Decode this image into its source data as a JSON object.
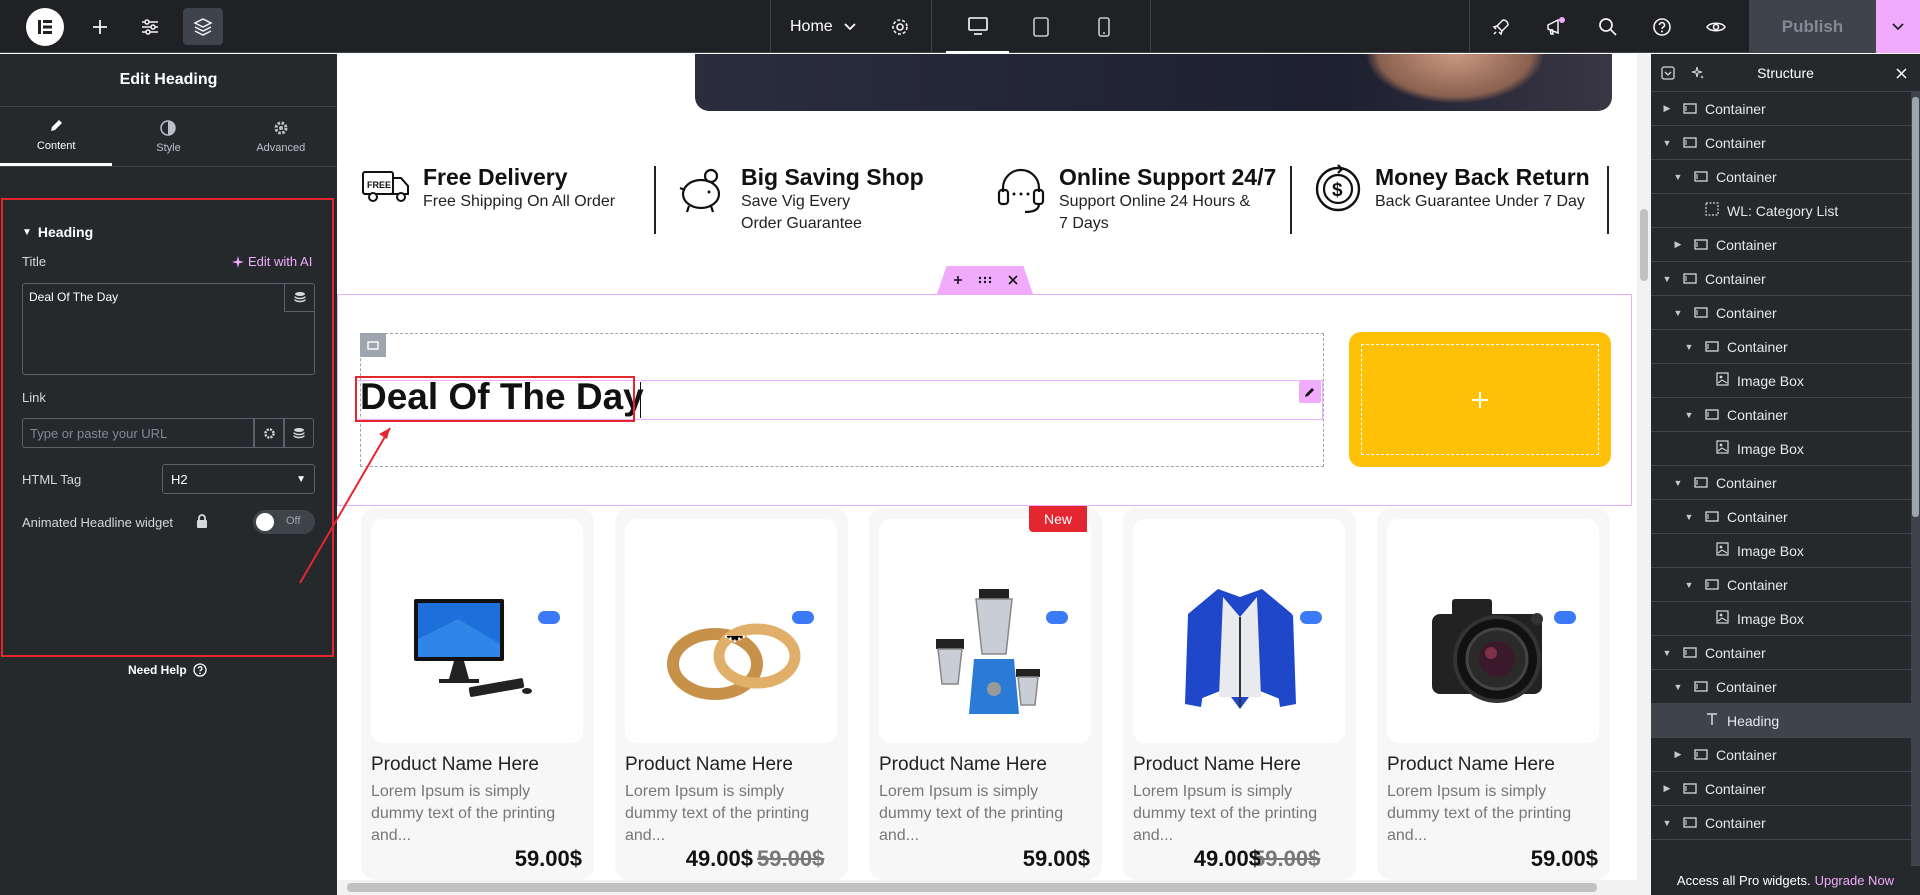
{
  "topbar": {
    "page_name": "Home",
    "publish_label": "Publish"
  },
  "left_panel": {
    "title": "Edit Heading",
    "tabs": [
      {
        "label": "Content"
      },
      {
        "label": "Style"
      },
      {
        "label": "Advanced"
      }
    ],
    "section_title": "Heading",
    "title_label": "Title",
    "edit_ai_label": "Edit with AI",
    "title_value": "Deal Of The Day",
    "link_label": "Link",
    "link_placeholder": "Type or paste your URL",
    "html_tag_label": "HTML Tag",
    "html_tag_value": "H2",
    "animated_label": "Animated Headline widget",
    "toggle_state": "Off",
    "need_help": "Need Help"
  },
  "canvas": {
    "features": [
      {
        "title": "Free Delivery",
        "lines": [
          "Free Shipping On All Order"
        ],
        "icon": "truck-icon"
      },
      {
        "title": "Big Saving Shop",
        "lines": [
          "Save Vig Every",
          "Order Guarantee"
        ],
        "icon": "piggy-bank-icon"
      },
      {
        "title": "Online Support 24/7",
        "lines": [
          "Support Online 24 Hours &",
          "7 Days"
        ],
        "icon": "headset-icon"
      },
      {
        "title": "Money Back Return",
        "lines": [
          "Back Guarantee Under 7 Day"
        ],
        "icon": "money-back-icon"
      }
    ],
    "heading": "Deal Of The Day",
    "products": [
      {
        "name": "Product Name Here",
        "desc": "Lorem Ipsum is simply dummy text of the printing and...",
        "price": "59.00$",
        "old_price": "",
        "badge": "",
        "image": "computer-icon"
      },
      {
        "name": "Product Name Here",
        "desc": "Lorem Ipsum is simply dummy text of the printing and...",
        "price": "49.00$",
        "old_price": "59.00$",
        "badge": "",
        "image": "rings-icon"
      },
      {
        "name": "Product Name Here",
        "desc": "Lorem Ipsum is simply dummy text of the printing and...",
        "price": "59.00$",
        "old_price": "",
        "badge": "New",
        "image": "blender-icon"
      },
      {
        "name": "Product Name Here",
        "desc": "Lorem Ipsum is simply dummy text of the printing and...",
        "price": "49.00$",
        "old_price": "59.00$",
        "badge": "",
        "image": "jacket-icon"
      },
      {
        "name": "Product Name Here",
        "desc": "Lorem Ipsum is simply dummy text of the printing and...",
        "price": "59.00$",
        "old_price": "",
        "badge": "",
        "image": "camera-icon"
      }
    ]
  },
  "structure": {
    "title": "Structure",
    "rows": [
      {
        "label": "Container",
        "arrow": "right",
        "icon": "container",
        "depth": 0
      },
      {
        "label": "Container",
        "arrow": "down",
        "icon": "container",
        "depth": 0
      },
      {
        "label": "Container",
        "arrow": "down",
        "icon": "container",
        "depth": 1
      },
      {
        "label": "WL: Category List",
        "arrow": "",
        "icon": "widget",
        "depth": 2
      },
      {
        "label": "Container",
        "arrow": "right",
        "icon": "container",
        "depth": 1
      },
      {
        "label": "Container",
        "arrow": "down",
        "icon": "container",
        "depth": 0
      },
      {
        "label": "Container",
        "arrow": "down",
        "icon": "container",
        "depth": 1
      },
      {
        "label": "Container",
        "arrow": "down",
        "icon": "container",
        "depth": 2
      },
      {
        "label": "Image Box",
        "arrow": "",
        "icon": "imagebox",
        "depth": 3
      },
      {
        "label": "Container",
        "arrow": "down",
        "icon": "container",
        "depth": 2
      },
      {
        "label": "Image Box",
        "arrow": "",
        "icon": "imagebox",
        "depth": 3
      },
      {
        "label": "Container",
        "arrow": "down",
        "icon": "container",
        "depth": 1
      },
      {
        "label": "Container",
        "arrow": "down",
        "icon": "container",
        "depth": 2
      },
      {
        "label": "Image Box",
        "arrow": "",
        "icon": "imagebox",
        "depth": 3
      },
      {
        "label": "Container",
        "arrow": "down",
        "icon": "container",
        "depth": 2
      },
      {
        "label": "Image Box",
        "arrow": "",
        "icon": "imagebox",
        "depth": 3
      },
      {
        "label": "Container",
        "arrow": "down",
        "icon": "container",
        "depth": 0
      },
      {
        "label": "Container",
        "arrow": "down",
        "icon": "container",
        "depth": 1
      },
      {
        "label": "Heading",
        "arrow": "",
        "icon": "heading",
        "depth": 2,
        "active": true
      },
      {
        "label": "Container",
        "arrow": "right",
        "icon": "container",
        "depth": 1
      },
      {
        "label": "Container",
        "arrow": "right",
        "icon": "container",
        "depth": 0
      },
      {
        "label": "Container",
        "arrow": "down",
        "icon": "container",
        "depth": 0
      }
    ],
    "footer_text": "Access all Pro widgets.",
    "upgrade_label": "Upgrade Now"
  },
  "colors": {
    "accent_pink": "#f0abfc",
    "panel_bg": "#26292c",
    "topbar_bg": "#1f2124",
    "annotation_red": "#e32630",
    "yellow": "#ffc107"
  }
}
